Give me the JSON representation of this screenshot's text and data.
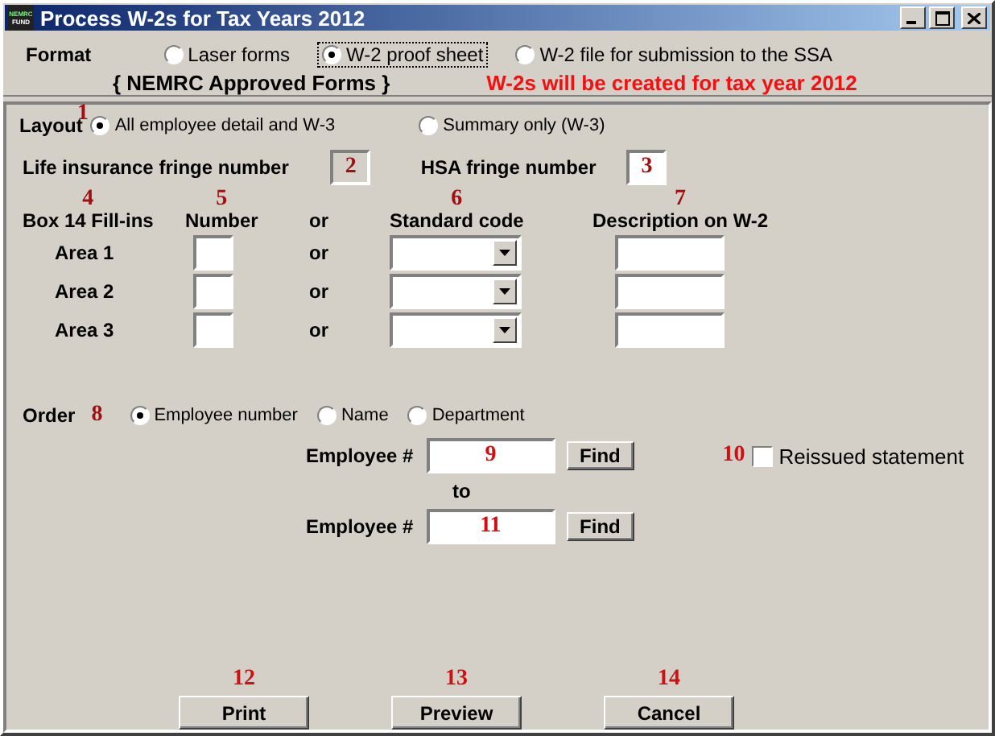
{
  "window": {
    "title": "Process W-2s for Tax Years 2012",
    "logo_lines": [
      "NEMRC",
      "FUND"
    ]
  },
  "format": {
    "label": "Format",
    "options": [
      {
        "label": "Laser forms",
        "selected": false,
        "focused": false
      },
      {
        "label": "W-2 proof sheet",
        "selected": true,
        "focused": true
      },
      {
        "label": "W-2 file for submission to the SSA",
        "selected": false,
        "focused": false
      }
    ],
    "note": "{ NEMRC  Approved Forms }",
    "notice": "W-2s will be created for tax year 2012"
  },
  "layout": {
    "label": "Layout",
    "callout": "1",
    "options": [
      {
        "label": "All employee detail and W-3",
        "selected": true
      },
      {
        "label": "Summary only (W-3)",
        "selected": false
      }
    ]
  },
  "fringe": [
    {
      "label": "Life insurance fringe number",
      "callout": "2",
      "disabled": true
    },
    {
      "label": "HSA fringe number",
      "callout": "3",
      "disabled": false
    }
  ],
  "box14": {
    "columns": [
      {
        "label": "Box 14 Fill-ins",
        "callout": "4"
      },
      {
        "label": "Number",
        "callout": "5"
      },
      {
        "label": "or"
      },
      {
        "label": "Standard code",
        "callout": "6"
      },
      {
        "label": "Description on W-2",
        "callout": "7"
      }
    ],
    "rows": [
      {
        "label": "Area 1",
        "or": "or"
      },
      {
        "label": "Area 2",
        "or": "or"
      },
      {
        "label": "Area 3",
        "or": "or"
      }
    ]
  },
  "order": {
    "label": "Order",
    "callout": "8",
    "options": [
      {
        "label": "Employee number",
        "selected": true
      },
      {
        "label": "Name",
        "selected": false
      },
      {
        "label": "Department",
        "selected": false
      }
    ],
    "from": {
      "label": "Employee #",
      "callout": "9",
      "button": "Find"
    },
    "to_label": "to",
    "to": {
      "label": "Employee #",
      "callout": "11",
      "button": "Find"
    },
    "reissued": {
      "callout": "10",
      "label": "Reissued statement",
      "checked": false
    }
  },
  "buttons": [
    {
      "label": "Print",
      "callout": "12"
    },
    {
      "label": "Preview",
      "callout": "13"
    },
    {
      "label": "Cancel",
      "callout": "14"
    }
  ]
}
